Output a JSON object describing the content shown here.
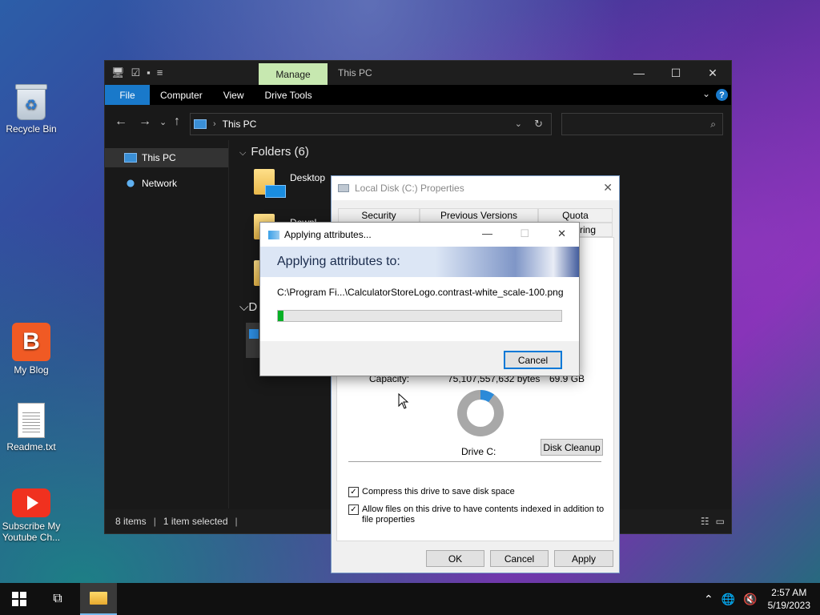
{
  "desktop": {
    "icons": [
      {
        "label": "Recycle Bin",
        "icon": "recycle-bin-icon"
      },
      {
        "label": "My Blog",
        "icon": "blogger-icon"
      },
      {
        "label": "Readme.txt",
        "icon": "text-file-icon"
      },
      {
        "label": "Subscribe My Youtube Ch...",
        "icon": "youtube-icon"
      }
    ]
  },
  "explorer": {
    "title": "This PC",
    "context_tab": "Manage",
    "ribbon_tabs": [
      "File",
      "Computer",
      "View",
      "Drive Tools"
    ],
    "address_path": "This PC",
    "search_placeholder": "",
    "sidebar": [
      {
        "label": "This PC",
        "icon": "computer-icon",
        "active": true
      },
      {
        "label": "Network",
        "icon": "network-icon",
        "active": false
      }
    ],
    "folders_header": "Folders (6)",
    "folders": [
      "Desktop",
      "Downl"
    ],
    "devices_header": "D",
    "status": {
      "items": "8 items",
      "selected": "1 item selected"
    }
  },
  "properties": {
    "title": "Local Disk (C:) Properties",
    "tabs": [
      "Security",
      "Previous Versions",
      "Quota",
      "ring"
    ],
    "capacity_label": "Capacity:",
    "capacity_bytes": "75,107,557,632 bytes",
    "capacity_gb": "69.9 GB",
    "drive_label": "Drive C:",
    "disk_cleanup": "Disk Cleanup",
    "compress_label": "Compress this drive to save disk space",
    "index_label": "Allow files on this drive to have contents indexed in addition to file properties",
    "buttons": {
      "ok": "OK",
      "cancel": "Cancel",
      "apply": "Apply"
    },
    "used_fraction": 0.1
  },
  "apply_dialog": {
    "title": "Applying attributes...",
    "heading": "Applying attributes to:",
    "path": "C:\\Program Fi...\\CalculatorStoreLogo.contrast-white_scale-100.png",
    "progress": 0.02,
    "cancel": "Cancel"
  },
  "taskbar": {
    "time": "2:57 AM",
    "date": "5/19/2023"
  },
  "colors": {
    "accent": "#1979ca",
    "manage_tab": "#c7e8b0",
    "progress": "#06b025",
    "focus_border": "#0078d7"
  }
}
